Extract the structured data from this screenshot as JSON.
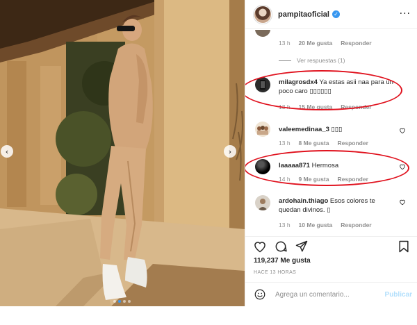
{
  "post": {
    "carousel_prev_glyph": "‹",
    "carousel_next_glyph": "›",
    "carousel_dot_count": 4,
    "carousel_active_dot": 1
  },
  "header": {
    "username": "pampitaoficial",
    "verified_glyph": "✓",
    "more_glyph": "···"
  },
  "comments": {
    "top_reply": {
      "time": "13 h",
      "likes": "20 Me gusta",
      "reply": "Responder"
    },
    "view_replies": "Ver respuestas (1)",
    "items": [
      {
        "user": "milagrosdx4",
        "text": "Ya estas asii naa para un poco caro ▯▯▯▯▯▯",
        "time": "13 h",
        "likes": "15 Me gusta",
        "reply": "Responder"
      },
      {
        "user": "valeemedinaa_3",
        "text": "▯▯▯",
        "time": "13 h",
        "likes": "8 Me gusta",
        "reply": "Responder"
      },
      {
        "user": "laaaaa871",
        "text": "Hermosa",
        "time": "14 h",
        "likes": "9 Me gusta",
        "reply": "Responder"
      },
      {
        "user": "ardohain.thiago",
        "text": "Esos colores te quedan divinos. ▯",
        "time": "13 h",
        "likes": "10 Me gusta",
        "reply": "Responder"
      }
    ]
  },
  "actions": {
    "likes": "119,237 Me gusta",
    "time_ago": "HACE 13 HORAS"
  },
  "comment_box": {
    "placeholder": "Agrega un comentario...",
    "publish_label": "Publicar"
  },
  "colors": {
    "highlight_ring": "#e0121e",
    "accent": "#3897f0",
    "muted_text": "#8e8e8e",
    "publish_disabled": "#b2dffc"
  }
}
